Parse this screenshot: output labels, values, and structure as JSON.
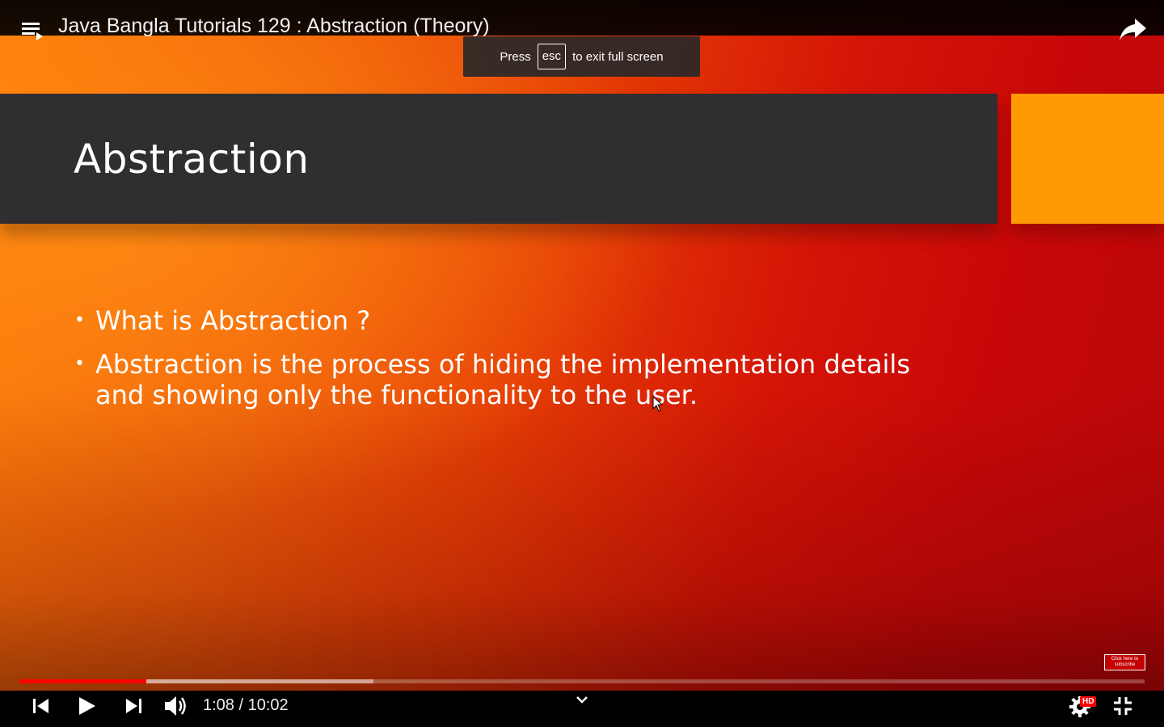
{
  "video": {
    "title": "Java Bangla Tutorials 129 : Abstraction (Theory)",
    "current_time": "1:08",
    "duration": "10:02",
    "time_display": "1:08 / 10:02",
    "played_fraction": 0.113,
    "buffered_fraction": 0.315,
    "quality_badge": "HD"
  },
  "fullscreen_toast": {
    "prefix": "Press",
    "key": "esc",
    "suffix": "to exit full screen"
  },
  "slide": {
    "title": "Abstraction",
    "bullets": [
      "What is Abstraction ?",
      "Abstraction is the process of hiding the implementation details and showing only the functionality to the user."
    ],
    "bullet_marker": "•"
  },
  "watermark": {
    "text_line1": "Click here to",
    "text_line2": "subscribe"
  },
  "icons": {
    "playlist": "playlist-icon",
    "share": "share-icon",
    "previous": "skip-previous-icon",
    "play": "play-icon",
    "next": "skip-next-icon",
    "volume": "volume-icon",
    "chevron": "chevron-down-icon",
    "settings": "gear-icon",
    "exit_fullscreen": "exit-fullscreen-icon"
  },
  "colors": {
    "progress_played": "#ff0000",
    "slide_title_bar": "#302e31",
    "slide_accent": "#ff9a05"
  }
}
